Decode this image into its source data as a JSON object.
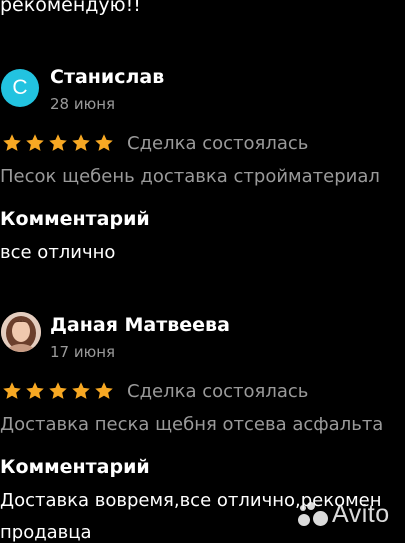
{
  "top_text": "рекомендую!!",
  "reviews": [
    {
      "avatar_letter": "С",
      "name": "Станислав",
      "date": "28 июня",
      "stars": 5,
      "deal_status": "Сделка состоялась",
      "product": "Песок щебень доставка стройматериал",
      "comment_title": "Комментарий",
      "comment": "все отлично",
      "colors": {
        "avatar_bg": "#22c3e0",
        "star": "#f7a823"
      }
    },
    {
      "name": "Даная Матвеева",
      "date": "17 июня",
      "stars": 5,
      "deal_status": "Сделка состоялась",
      "product": "Доставка песка щебня отсева асфальта",
      "comment_title": "Комментарий",
      "comment": "Доставка вовремя,все отлично,рекомен",
      "comment_line2": "продавца"
    }
  ],
  "watermark": {
    "text": "Avito"
  }
}
